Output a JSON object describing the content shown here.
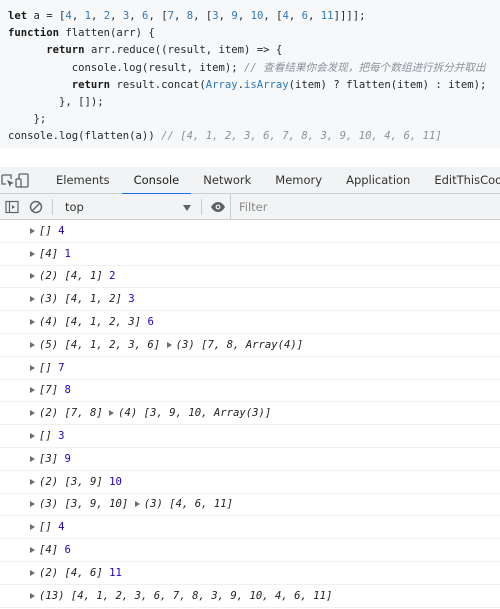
{
  "code": {
    "lines": [
      [
        {
          "t": "let",
          "c": "kw"
        },
        {
          "t": " a = ["
        },
        {
          "t": "4",
          "c": "num"
        },
        {
          "t": ", "
        },
        {
          "t": "1",
          "c": "num"
        },
        {
          "t": ", "
        },
        {
          "t": "2",
          "c": "num"
        },
        {
          "t": ", "
        },
        {
          "t": "3",
          "c": "num"
        },
        {
          "t": ", "
        },
        {
          "t": "6",
          "c": "num"
        },
        {
          "t": ", ["
        },
        {
          "t": "7",
          "c": "num"
        },
        {
          "t": ", "
        },
        {
          "t": "8",
          "c": "num"
        },
        {
          "t": ", ["
        },
        {
          "t": "3",
          "c": "num"
        },
        {
          "t": ", "
        },
        {
          "t": "9",
          "c": "num"
        },
        {
          "t": ", "
        },
        {
          "t": "10",
          "c": "num"
        },
        {
          "t": ", ["
        },
        {
          "t": "4",
          "c": "num"
        },
        {
          "t": ", "
        },
        {
          "t": "6",
          "c": "num"
        },
        {
          "t": ", "
        },
        {
          "t": "11",
          "c": "num"
        },
        {
          "t": "]]]];"
        }
      ],
      [
        {
          "t": "function",
          "c": "kw"
        },
        {
          "t": " flatten(arr) {"
        }
      ],
      [
        {
          "t": "      "
        },
        {
          "t": "return",
          "c": "kw"
        },
        {
          "t": " arr.reduce((result, item) => {"
        }
      ],
      [
        {
          "t": "          console.log(result, item); "
        },
        {
          "t": "// 查看结果你会发现，把每个数组进行拆分并取出",
          "c": "cmt"
        }
      ],
      [
        {
          "t": "          "
        },
        {
          "t": "return",
          "c": "kw"
        },
        {
          "t": " result.concat("
        },
        {
          "t": "Array",
          "c": "builtin"
        },
        {
          "t": "."
        },
        {
          "t": "isArray",
          "c": "builtin"
        },
        {
          "t": "(item) ? flatten(item) : item);"
        }
      ],
      [
        {
          "t": "        }, []);"
        }
      ],
      [
        {
          "t": "    };"
        }
      ],
      [
        {
          "t": "console.log(flatten(a)) "
        },
        {
          "t": "// [4, 1, 2, 3, 6, 7, 8, 3, 9, 10, 4, 6, 11]",
          "c": "cmt"
        }
      ]
    ]
  },
  "devtools": {
    "tabs": [
      "Elements",
      "Console",
      "Network",
      "Memory",
      "Application",
      "EditThisCookie"
    ],
    "active_tab": "Console",
    "toolbar": {
      "context_label": "top",
      "filter_placeholder": "Filter"
    }
  },
  "console": {
    "messages": [
      {
        "parts": [
          {
            "arr": "[]"
          },
          {
            "val": " 4"
          }
        ]
      },
      {
        "parts": [
          {
            "arr": "[4]"
          },
          {
            "val": " 1"
          }
        ]
      },
      {
        "parts": [
          {
            "arr": "(2) [4, 1]"
          },
          {
            "val": " 2"
          }
        ]
      },
      {
        "parts": [
          {
            "arr": "(3) [4, 1, 2]"
          },
          {
            "val": " 3"
          }
        ]
      },
      {
        "parts": [
          {
            "arr": "(4) [4, 1, 2, 3]"
          },
          {
            "val": " 6"
          }
        ]
      },
      {
        "parts": [
          {
            "arr": "(5) [4, 1, 2, 3, 6]"
          },
          {
            "text": " "
          },
          {
            "arr": "(3) [7, 8, Array(4)]"
          }
        ]
      },
      {
        "parts": [
          {
            "arr": "[]"
          },
          {
            "val": " 7"
          }
        ]
      },
      {
        "parts": [
          {
            "arr": "[7]"
          },
          {
            "val": " 8"
          }
        ]
      },
      {
        "parts": [
          {
            "arr": "(2) [7, 8]"
          },
          {
            "text": " "
          },
          {
            "arr": "(4) [3, 9, 10, Array(3)]"
          }
        ]
      },
      {
        "parts": [
          {
            "arr": "[]"
          },
          {
            "val": " 3"
          }
        ]
      },
      {
        "parts": [
          {
            "arr": "[3]"
          },
          {
            "val": " 9"
          }
        ]
      },
      {
        "parts": [
          {
            "arr": "(2) [3, 9]"
          },
          {
            "val": " 10"
          }
        ]
      },
      {
        "parts": [
          {
            "arr": "(3) [3, 9, 10]"
          },
          {
            "text": " "
          },
          {
            "arr": "(3) [4, 6, 11]"
          }
        ]
      },
      {
        "parts": [
          {
            "arr": "[]"
          },
          {
            "val": " 4"
          }
        ]
      },
      {
        "parts": [
          {
            "arr": "[4]"
          },
          {
            "val": " 6"
          }
        ]
      },
      {
        "parts": [
          {
            "arr": "(2) [4, 6]"
          },
          {
            "val": " 11"
          }
        ]
      },
      {
        "parts": [
          {
            "arr": "(13) [4, 1, 2, 3, 6, 7, 8, 3, 9, 10, 4, 6, 11]"
          }
        ]
      }
    ],
    "prompt_symbol": "›"
  },
  "icons": {
    "inspect": "inspect-element-icon",
    "device": "device-toolbar-icon",
    "sidebar": "console-sidebar-icon",
    "clear": "clear-console-icon",
    "eye": "live-expression-icon",
    "expand": "expand-triangle-icon"
  },
  "colors": {
    "accent": "#1a73e8",
    "console_value": "#1c00cf",
    "code_number": "#2f7ab8",
    "code_comment": "#8a9199"
  }
}
